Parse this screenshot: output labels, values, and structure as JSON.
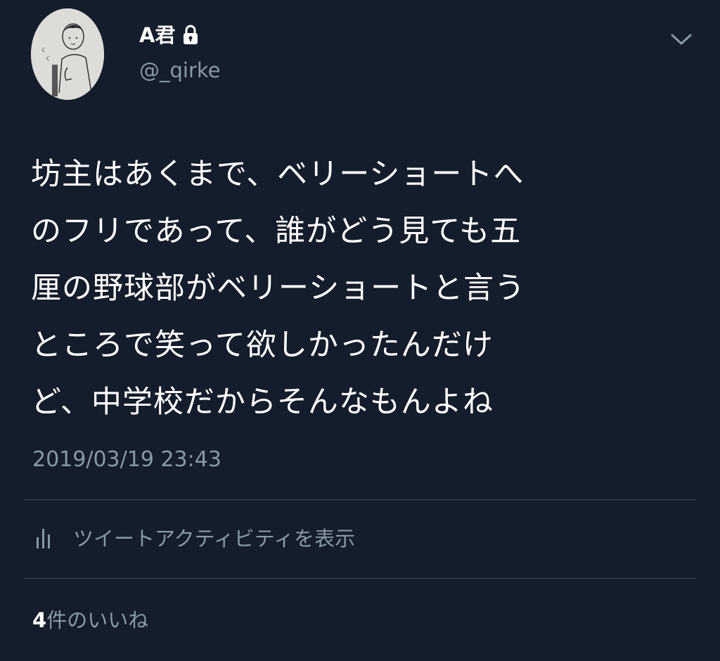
{
  "user": {
    "display_name": "A君",
    "handle": "@_qirke",
    "protected": true
  },
  "icons": {
    "lock": "lock-icon",
    "menu": "chevron-down-icon",
    "activity": "bar-chart-icon"
  },
  "tweet": {
    "text": "坊主はあくまで、ベリーショートへ\nのフリであって、誰がどう見ても五\n厘の野球部がベリーショートと言う\nところで笑って欲しかったんだけ\nど、中学校だからそんなもんよね",
    "timestamp": "2019/03/19 23:43"
  },
  "activity": {
    "label": "ツイートアクティビティを表示"
  },
  "likes": {
    "count": "4",
    "label": "件のいいね"
  },
  "colors": {
    "background": "#141d2b",
    "secondary_text": "#8899a6",
    "divider": "#38444d"
  }
}
